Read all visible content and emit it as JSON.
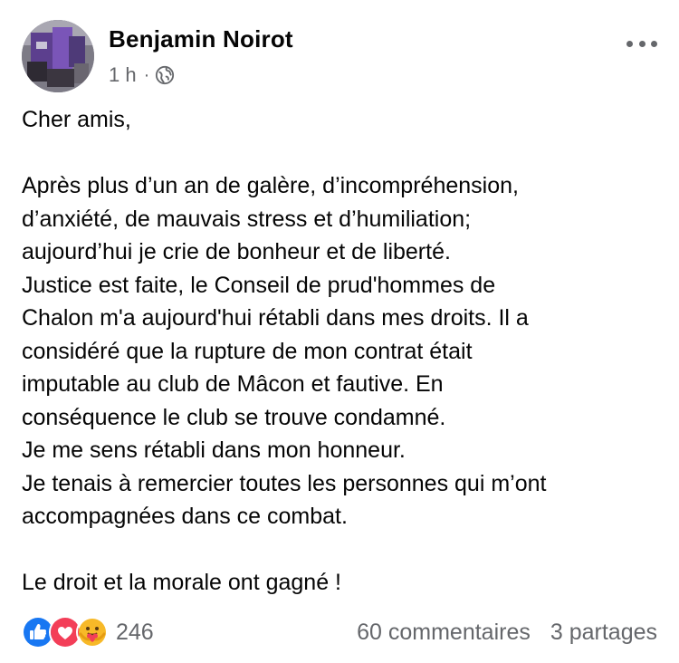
{
  "post": {
    "author": "Benjamin Noirot",
    "time": "1 h",
    "separator": "·",
    "audience_icon": "globe-icon",
    "body_lines": [
      "Cher amis,",
      "",
      "Après plus d’un an de galère, d’incompréhension,",
      "d’anxiété, de mauvais stress et d’humiliation;",
      "aujourd’hui je crie de bonheur et de liberté.",
      "Justice est faite, le Conseil de prud'hommes de",
      "Chalon m'a aujourd'hui rétabli dans mes droits. Il a",
      "considéré que la rupture de mon contrat était",
      "imputable au club de Mâcon et fautive. En",
      "conséquence le club se trouve condamné.",
      "Je me sens rétabli dans mon honneur.",
      "Je tenais à remercier toutes les personnes qui m’ont",
      "accompagnées dans ce combat.",
      "",
      "Le droit et la morale ont gagné !"
    ]
  },
  "footer": {
    "reactions": [
      "like-icon",
      "love-icon",
      "care-icon"
    ],
    "reaction_count": "246",
    "comments": "60 commentaires",
    "shares": "3 partages"
  },
  "colors": {
    "text": "#050505",
    "secondary": "#65676b",
    "like_blue": "#1877f2",
    "love_red": "#f33e58",
    "care_yellow": "#f7b928"
  }
}
